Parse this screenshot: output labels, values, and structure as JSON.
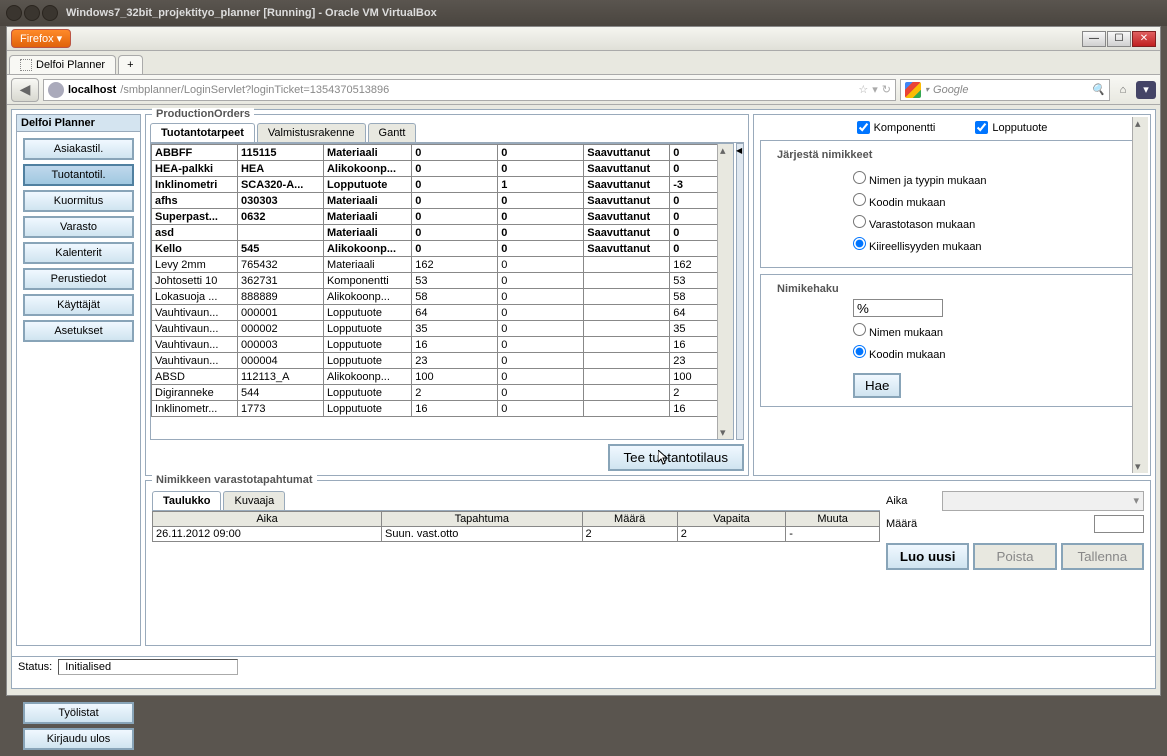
{
  "vm_title": "Windows7_32bit_projektityo_planner [Running] - Oracle VM VirtualBox",
  "firefox_label": "Firefox ▾",
  "tab_title": "Delfoi Planner",
  "url_host": "localhost",
  "url_path": "/smbplanner/LoginServlet?loginTicket=1354370513896",
  "search_placeholder": "Google",
  "sidebar": {
    "title": "Delfoi Planner",
    "items": [
      "Asiakastil.",
      "Tuotantotil.",
      "Kuormitus",
      "Varasto",
      "Kalenterit",
      "Perustiedot",
      "Käyttäjät",
      "Asetukset"
    ],
    "bottom": [
      "Työlistat",
      "Kirjaudu ulos"
    ]
  },
  "prod": {
    "legend": "ProductionOrders",
    "tabs": [
      "Tuotantotarpeet",
      "Valmistusrakenne",
      "Gantt"
    ],
    "action_btn": "Tee tuotantotilaus",
    "rows": [
      {
        "bold": true,
        "c": [
          "ABBFF",
          "115115",
          "Materiaali",
          "0",
          "0",
          "Saavuttanut",
          "0"
        ]
      },
      {
        "bold": true,
        "c": [
          "HEA-palkki",
          "HEA",
          "Alikokoonp...",
          "0",
          "0",
          "Saavuttanut",
          "0"
        ]
      },
      {
        "bold": true,
        "c": [
          "Inklinometri",
          "SCA320-A...",
          "Lopputuote",
          "0",
          "1",
          "Saavuttanut",
          "-3"
        ]
      },
      {
        "bold": true,
        "c": [
          "afhs",
          "030303",
          "Materiaali",
          "0",
          "0",
          "Saavuttanut",
          "0"
        ]
      },
      {
        "bold": true,
        "c": [
          "Superpast...",
          "0632",
          "Materiaali",
          "0",
          "0",
          "Saavuttanut",
          "0"
        ]
      },
      {
        "bold": true,
        "c": [
          "asd",
          "",
          "Materiaali",
          "0",
          "0",
          "Saavuttanut",
          "0"
        ]
      },
      {
        "bold": true,
        "c": [
          "Kello",
          "545",
          "Alikokoonp...",
          "0",
          "0",
          "Saavuttanut",
          "0"
        ]
      },
      {
        "bold": false,
        "c": [
          "Levy 2mm",
          "765432",
          "Materiaali",
          "162",
          "0",
          "",
          "162"
        ]
      },
      {
        "bold": false,
        "c": [
          "Johtosetti 10",
          "362731",
          "Komponentti",
          "53",
          "0",
          "",
          "53"
        ]
      },
      {
        "bold": false,
        "c": [
          "Lokasuoja ...",
          "888889",
          "Alikokoonp...",
          "58",
          "0",
          "",
          "58"
        ]
      },
      {
        "bold": false,
        "c": [
          "Vauhtivaun...",
          "000001",
          "Lopputuote",
          "64",
          "0",
          "",
          "64"
        ]
      },
      {
        "bold": false,
        "c": [
          "Vauhtivaun...",
          "000002",
          "Lopputuote",
          "35",
          "0",
          "",
          "35"
        ]
      },
      {
        "bold": false,
        "c": [
          "Vauhtivaun...",
          "000003",
          "Lopputuote",
          "16",
          "0",
          "",
          "16"
        ]
      },
      {
        "bold": false,
        "c": [
          "Vauhtivaun...",
          "000004",
          "Lopputuote",
          "23",
          "0",
          "",
          "23"
        ]
      },
      {
        "bold": false,
        "c": [
          "ABSD",
          "112113_A",
          "Alikokoonp...",
          "100",
          "0",
          "",
          "100"
        ]
      },
      {
        "bold": false,
        "c": [
          "Digiranneke",
          "544",
          "Lopputuote",
          "2",
          "0",
          "",
          "2"
        ]
      },
      {
        "bold": false,
        "c": [
          "Inklinometr...",
          "1773",
          "Lopputuote",
          "16",
          "0",
          "",
          "16"
        ]
      }
    ]
  },
  "filter": {
    "chk1": "Komponentti",
    "chk2": "Lopputuote",
    "sort_legend": "Järjestä nimikkeet",
    "sort_opts": [
      "Nimen ja tyypin mukaan",
      "Koodin mukaan",
      "Varastotason mukaan",
      "Kiireellisyyden mukaan"
    ],
    "sort_sel": 3,
    "search_legend": "Nimikehaku",
    "search_val": "%",
    "search_opts": [
      "Nimen mukaan",
      "Koodin mukaan"
    ],
    "search_sel": 1,
    "search_btn": "Hae"
  },
  "events": {
    "legend": "Nimikkeen varastotapahtumat",
    "tabs": [
      "Taulukko",
      "Kuvaaja"
    ],
    "headers": [
      "Aika",
      "Tapahtuma",
      "Määrä",
      "Vapaita",
      "Muuta"
    ],
    "row": [
      "26.11.2012 09:00",
      "Suun. vast.otto",
      "2",
      "2",
      "-"
    ],
    "right_labels": {
      "aika": "Aika",
      "maara": "Määrä"
    },
    "btns": [
      "Luo uusi",
      "Poista",
      "Tallenna"
    ]
  },
  "status": {
    "label": "Status:",
    "value": "Initialised"
  }
}
